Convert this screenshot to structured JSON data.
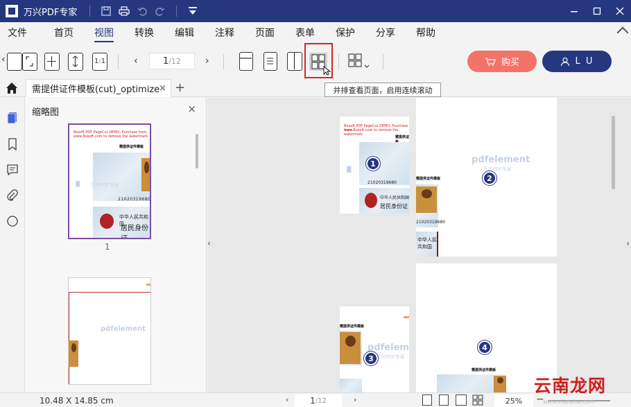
{
  "titlebar": {
    "app_title": "万兴PDF专家",
    "icons": [
      "save-icon",
      "print-icon",
      "undo-icon",
      "redo-icon",
      "dropdown-icon"
    ]
  },
  "window_controls": [
    "minimize-icon",
    "maximize-icon",
    "close-icon"
  ],
  "menu": {
    "items": [
      "文件",
      "首页",
      "视图",
      "转换",
      "编辑",
      "注释",
      "页面",
      "表单",
      "保护",
      "分享",
      "帮助"
    ],
    "active": "视图"
  },
  "toolbar": {
    "page_current": "1",
    "page_total": "/12",
    "zoom_fit_label": "1:1",
    "buy_label": "购买",
    "user_label": "L U",
    "tooltip": "并排查看页面，启用连续滚动"
  },
  "tabs": {
    "doc_tab_label": "需提供证件模板(cut)_optimize",
    "close_glyph": "×",
    "add_glyph": "+"
  },
  "thumbnail_panel": {
    "title": "缩略图",
    "close_glyph": "×",
    "page_label_1": "1"
  },
  "pages": {
    "badge_1": "1",
    "badge_2": "2",
    "badge_3": "3",
    "badge_4": "4",
    "watermark_brand": "pdfelement",
    "watermark_sub": "万兴PDF专家",
    "header_text_1": "Boxoft PDF PageCut DEMO: Purchase from",
    "header_text_2": "www.Boxoft.com to remove the watermark",
    "doc_heading": "需提供证件模板",
    "id_number": "21020319680",
    "id_ethnicity_text": "中华人民共和国",
    "id_card_text": "居民身份证"
  },
  "statusbar": {
    "dimensions": "10.48 X 14.85 cm",
    "page_current": "1",
    "page_total": "/12",
    "zoom": "25%"
  },
  "brand_watermark": {
    "text": "云南龙网",
    "sub": "www.xiazaiba.com"
  },
  "colors": {
    "primary": "#26367f",
    "buy": "#f37368",
    "highlight": "#d32727",
    "thumb_selected": "#7a4ca5"
  }
}
